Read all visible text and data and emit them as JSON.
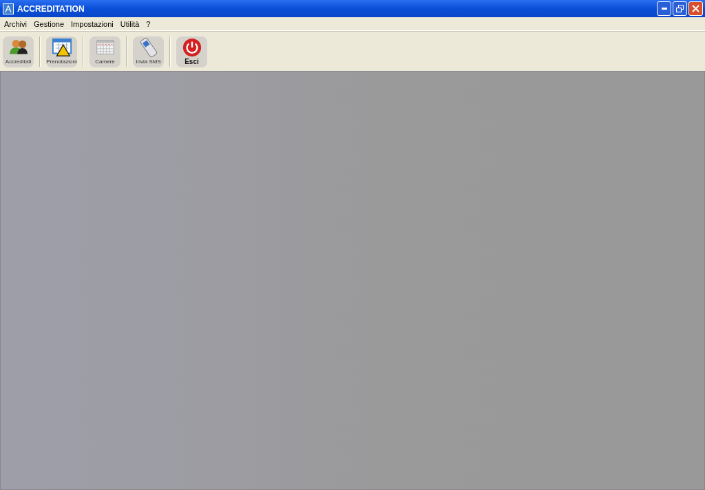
{
  "window": {
    "title": "ACCREDITATION"
  },
  "menu": [
    "Archivi",
    "Gestione",
    "Impostazioni",
    "Utilità",
    "?"
  ],
  "toolbar": [
    {
      "label": "Accreditati",
      "kind": "people"
    },
    {
      "label": "Prenotazioni",
      "kind": "calendar-warning"
    },
    {
      "label": "Camere",
      "kind": "calendar"
    },
    {
      "label": "Invia SMS",
      "kind": "phone"
    },
    {
      "label": "Esci",
      "kind": "power"
    }
  ]
}
